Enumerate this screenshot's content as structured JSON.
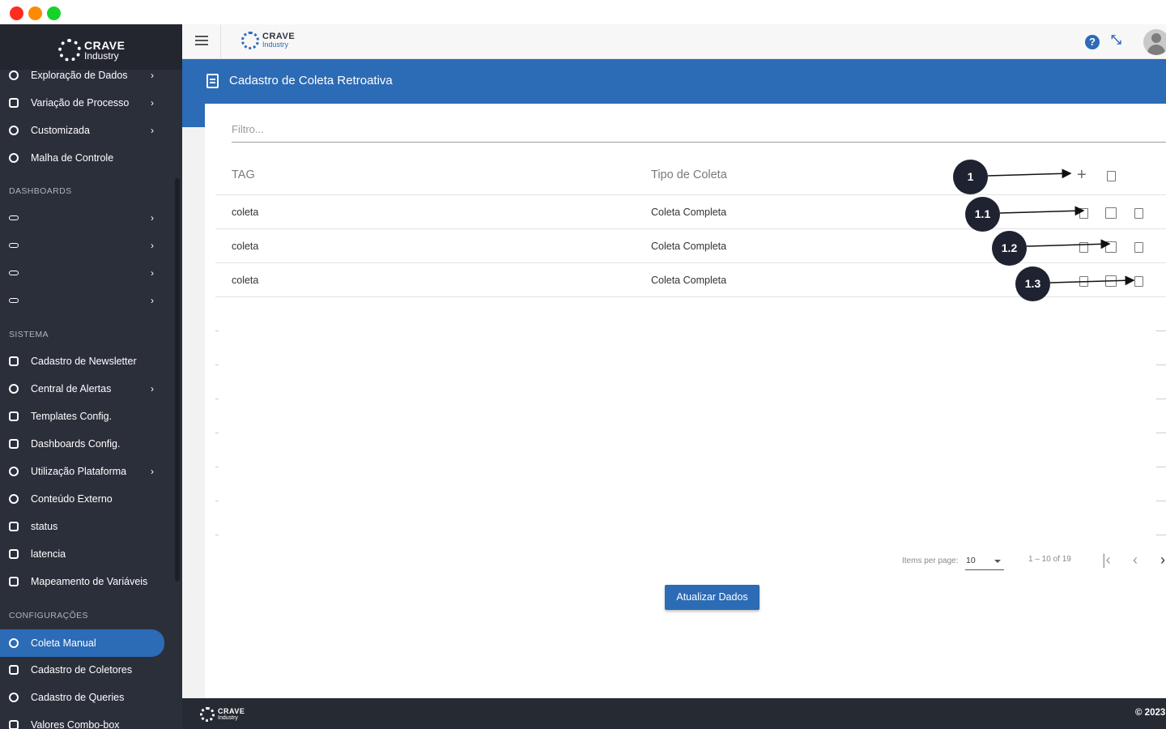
{
  "brand": {
    "name": "CRAVE",
    "sub": "Industry"
  },
  "sidebar": {
    "items_top": [
      {
        "label": "Exploração de Dados",
        "icon": "compass-icon",
        "chevron": true
      },
      {
        "label": "Variação de Processo",
        "icon": "chart-icon",
        "chevron": true
      },
      {
        "label": "Customizada",
        "icon": "palette-icon",
        "chevron": true
      },
      {
        "label": "Malha de Controle",
        "icon": "loop-icon",
        "chevron": false
      }
    ],
    "section_dashboards": "DASHBOARDS",
    "section_sistema": "SISTEMA",
    "sistema_items": [
      {
        "label": "Cadastro de Newsletter",
        "icon": "newsletter-icon",
        "chevron": false
      },
      {
        "label": "Central de Alertas",
        "icon": "bell-icon",
        "chevron": true
      },
      {
        "label": "Templates Config.",
        "icon": "template-icon",
        "chevron": false
      },
      {
        "label": "Dashboards Config.",
        "icon": "dashboard-icon",
        "chevron": false
      },
      {
        "label": "Utilização Plataforma",
        "icon": "circle-icon",
        "chevron": true
      },
      {
        "label": "Conteúdo Externo",
        "icon": "external-content-icon",
        "chevron": false
      },
      {
        "label": "status",
        "icon": "status-icon",
        "chevron": false
      },
      {
        "label": "latencia",
        "icon": "latency-icon",
        "chevron": false
      },
      {
        "label": "Mapeamento de Variáveis",
        "icon": "map-icon",
        "chevron": false
      }
    ],
    "section_config": "CONFIGURAÇÕES",
    "config_items": [
      {
        "label": "Coleta Manual",
        "icon": "refresh-icon",
        "active": true
      },
      {
        "label": "Cadastro de Coletores",
        "icon": "grid-icon",
        "active": false
      },
      {
        "label": "Cadastro de Queries",
        "icon": "query-icon",
        "active": false
      },
      {
        "label": "Valores Combo-box",
        "icon": "pin-icon",
        "active": false
      }
    ]
  },
  "page": {
    "title": "Cadastro de Coleta Retroativa",
    "filter_placeholder": "Filtro...",
    "table": {
      "headers": [
        "TAG",
        "Tipo de Coleta"
      ],
      "rows": [
        [
          "coleta",
          "Coleta Completa"
        ],
        [
          "coleta",
          "Coleta Completa"
        ],
        [
          "coleta",
          "Coleta Completa"
        ]
      ]
    },
    "paginator": {
      "items_per_page_label": "Items per page:",
      "items_per_page_value": "10",
      "range": "1 – 10 of 19"
    },
    "update_button": "Atualizar Dados"
  },
  "callouts": [
    "1",
    "1.1",
    "1.2",
    "1.3"
  ],
  "footer": {
    "copyright": "© 2023"
  },
  "colors": {
    "primary": "#2c6bb5",
    "sidebar": "#2b2f3a",
    "footer": "#262a33"
  }
}
